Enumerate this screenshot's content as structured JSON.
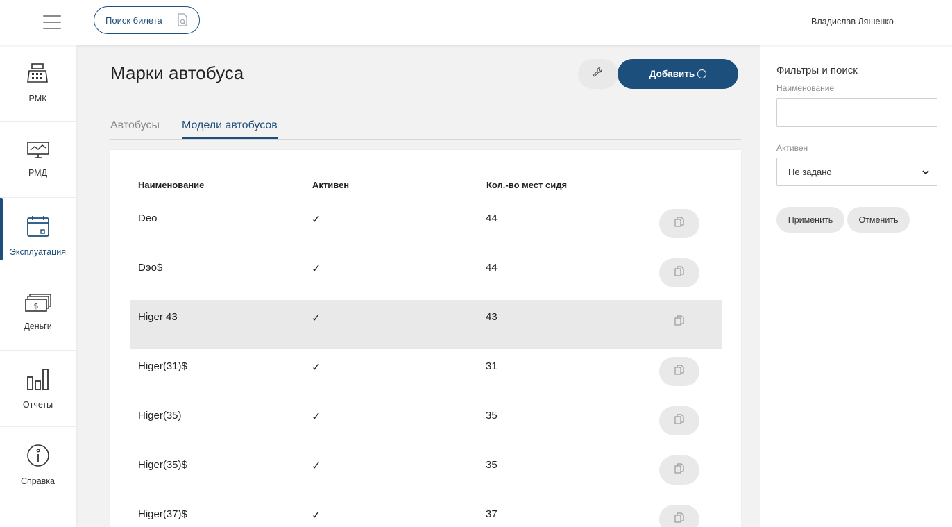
{
  "header": {
    "ticket_search_label": "Поиск билета",
    "user_name": "Владислав Ляшенко"
  },
  "sidebar": {
    "items": [
      {
        "label": "РМК",
        "icon": "cash-register-icon"
      },
      {
        "label": "РМД",
        "icon": "monitor-icon"
      },
      {
        "label": "Эксплуатация",
        "icon": "calendar-icon",
        "active": true
      },
      {
        "label": "Деньги",
        "icon": "money-icon"
      },
      {
        "label": "Отчеты",
        "icon": "bar-chart-icon"
      },
      {
        "label": "Справка",
        "icon": "info-icon"
      }
    ]
  },
  "main": {
    "title": "Марки автобуса",
    "add_label": "Добавить",
    "tabs": [
      {
        "label": "Автобусы",
        "active": false
      },
      {
        "label": "Модели автобусов",
        "active": true
      }
    ],
    "table": {
      "columns": [
        "Наименование",
        "Активен",
        "Кол.-во мест сидя"
      ],
      "rows": [
        {
          "name": "Deo",
          "active": "✓",
          "seats": "44"
        },
        {
          "name": "Dэо$",
          "active": "✓",
          "seats": "44"
        },
        {
          "name": "Higer 43",
          "active": "✓",
          "seats": "43",
          "highlighted": true
        },
        {
          "name": "Higer(31)$",
          "active": "✓",
          "seats": "31"
        },
        {
          "name": "Higer(35)",
          "active": "✓",
          "seats": "35"
        },
        {
          "name": "Higer(35)$",
          "active": "✓",
          "seats": "35"
        },
        {
          "name": "Higer(37)$",
          "active": "✓",
          "seats": "37"
        }
      ]
    }
  },
  "filters": {
    "title": "Фильтры и поиск",
    "name_label": "Наименование",
    "name_value": "",
    "active_label": "Активен",
    "active_value": "Не задано",
    "apply_label": "Применить",
    "cancel_label": "Отменить"
  },
  "colors": {
    "accent": "#1d4f7c",
    "button_bg": "#e9e9e9",
    "row_highlight": "#e9e9e9"
  }
}
